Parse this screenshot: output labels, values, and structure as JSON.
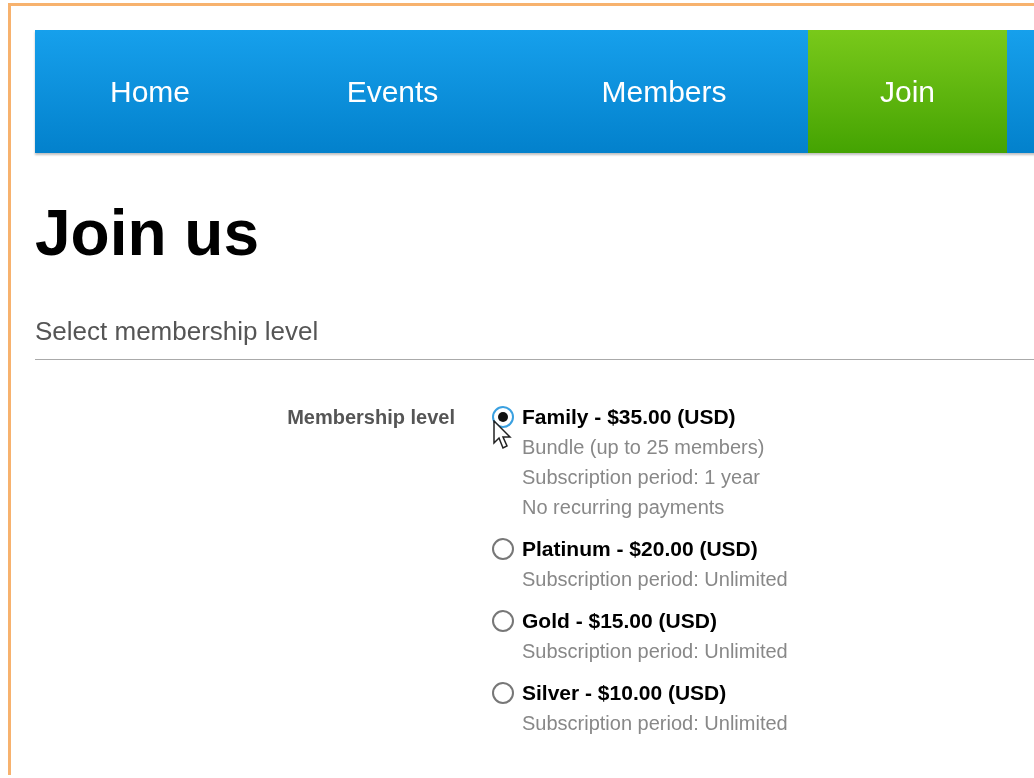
{
  "nav": [
    {
      "label": "Home",
      "selected": false
    },
    {
      "label": "Events",
      "selected": false
    },
    {
      "label": "Members",
      "selected": false
    },
    {
      "label": "Join",
      "selected": true
    }
  ],
  "heading": "Join us",
  "section_title": "Select membership level",
  "field_label": "Membership level",
  "options": [
    {
      "title": "Family - $35.00 (USD)",
      "details": [
        "Bundle (up to 25 members)",
        "Subscription period: 1 year",
        "No recurring payments"
      ],
      "selected": true
    },
    {
      "title": "Platinum - $20.00 (USD)",
      "details": [
        "Subscription period: Unlimited"
      ],
      "selected": false
    },
    {
      "title": "Gold - $15.00 (USD)",
      "details": [
        "Subscription period: Unlimited"
      ],
      "selected": false
    },
    {
      "title": "Silver - $10.00 (USD)",
      "details": [
        "Subscription period: Unlimited"
      ],
      "selected": false
    }
  ]
}
